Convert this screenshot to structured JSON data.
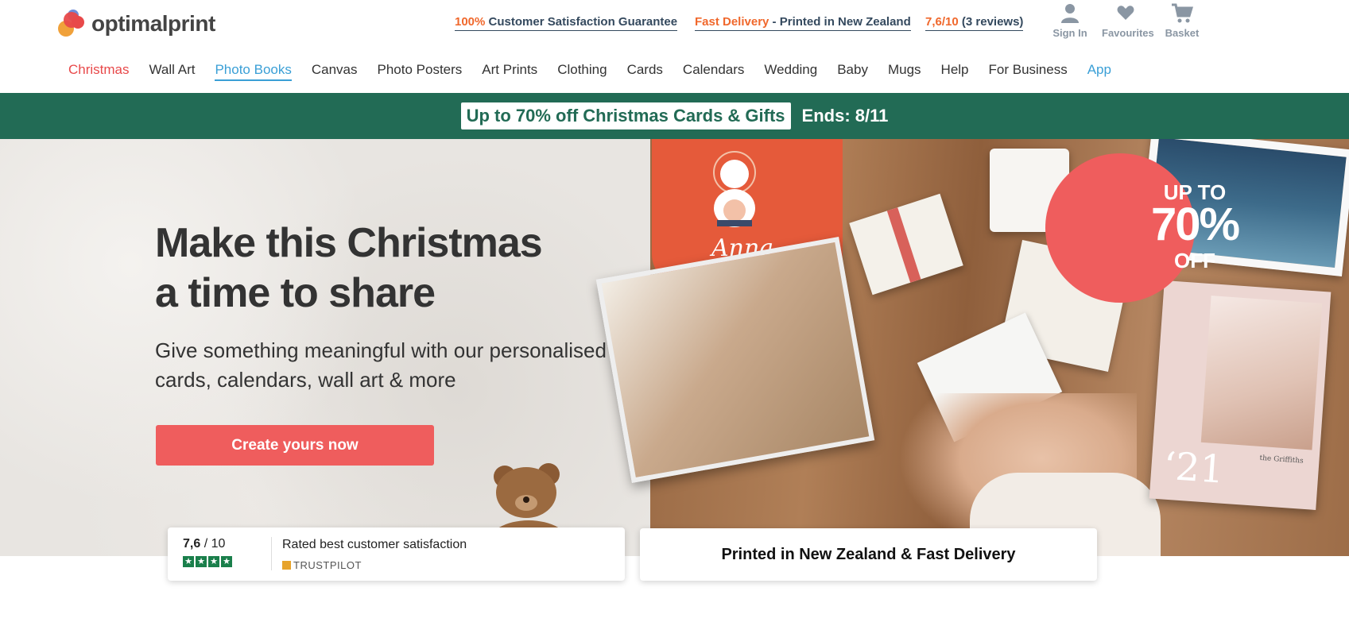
{
  "header": {
    "logo_text": "optimalprint",
    "usps": [
      {
        "highlight": "100%",
        "text": " Customer Satisfaction Guarantee"
      },
      {
        "highlight": "Fast Delivery",
        "text": " - Printed in New Zealand"
      },
      {
        "highlight": "7,6/10",
        "text": " (3 reviews)"
      }
    ],
    "icons": [
      {
        "label": "Sign In",
        "icon": "user-icon"
      },
      {
        "label": "Favourites",
        "icon": "heart-icon"
      },
      {
        "label": "Basket",
        "icon": "cart-icon"
      }
    ]
  },
  "nav": {
    "items": [
      {
        "label": "Christmas",
        "style": "red"
      },
      {
        "label": "Wall Art",
        "style": "normal"
      },
      {
        "label": "Photo Books",
        "style": "active"
      },
      {
        "label": "Canvas",
        "style": "normal"
      },
      {
        "label": "Photo Posters",
        "style": "normal"
      },
      {
        "label": "Art Prints",
        "style": "normal"
      },
      {
        "label": "Clothing",
        "style": "normal"
      },
      {
        "label": "Cards",
        "style": "normal"
      },
      {
        "label": "Calendars",
        "style": "normal"
      },
      {
        "label": "Wedding",
        "style": "normal"
      },
      {
        "label": "Baby",
        "style": "normal"
      },
      {
        "label": "Mugs",
        "style": "normal"
      },
      {
        "label": "Help",
        "style": "normal"
      },
      {
        "label": "For Business",
        "style": "normal"
      },
      {
        "label": "App",
        "style": "blue"
      }
    ]
  },
  "promo": {
    "offer": "Up to 70% off Christmas Cards & Gifts",
    "ends": "Ends: 8/11",
    "bg_color": "#226b55"
  },
  "hero": {
    "title_line1": "Make this Christmas",
    "title_line2": "a time to share",
    "subtitle_line1": "Give something meaningful with our personalised",
    "subtitle_line2": "cards, calendars, wall art & more",
    "cta_label": "Create yours now",
    "cta_color": "#ef5d5d",
    "tshirt_name": "Anna",
    "calendar_year": "‘21",
    "calendar_family": "the Griffiths",
    "badge": {
      "line1": "UP TO",
      "line2": "70%",
      "line3": "OFF"
    }
  },
  "rating": {
    "score": "7,6",
    "scale": " / 10",
    "stars": 4,
    "text": "Rated best customer satisfaction",
    "source": "TRUSTPILOT"
  },
  "delivery": {
    "text": "Printed in New Zealand & Fast Delivery"
  }
}
